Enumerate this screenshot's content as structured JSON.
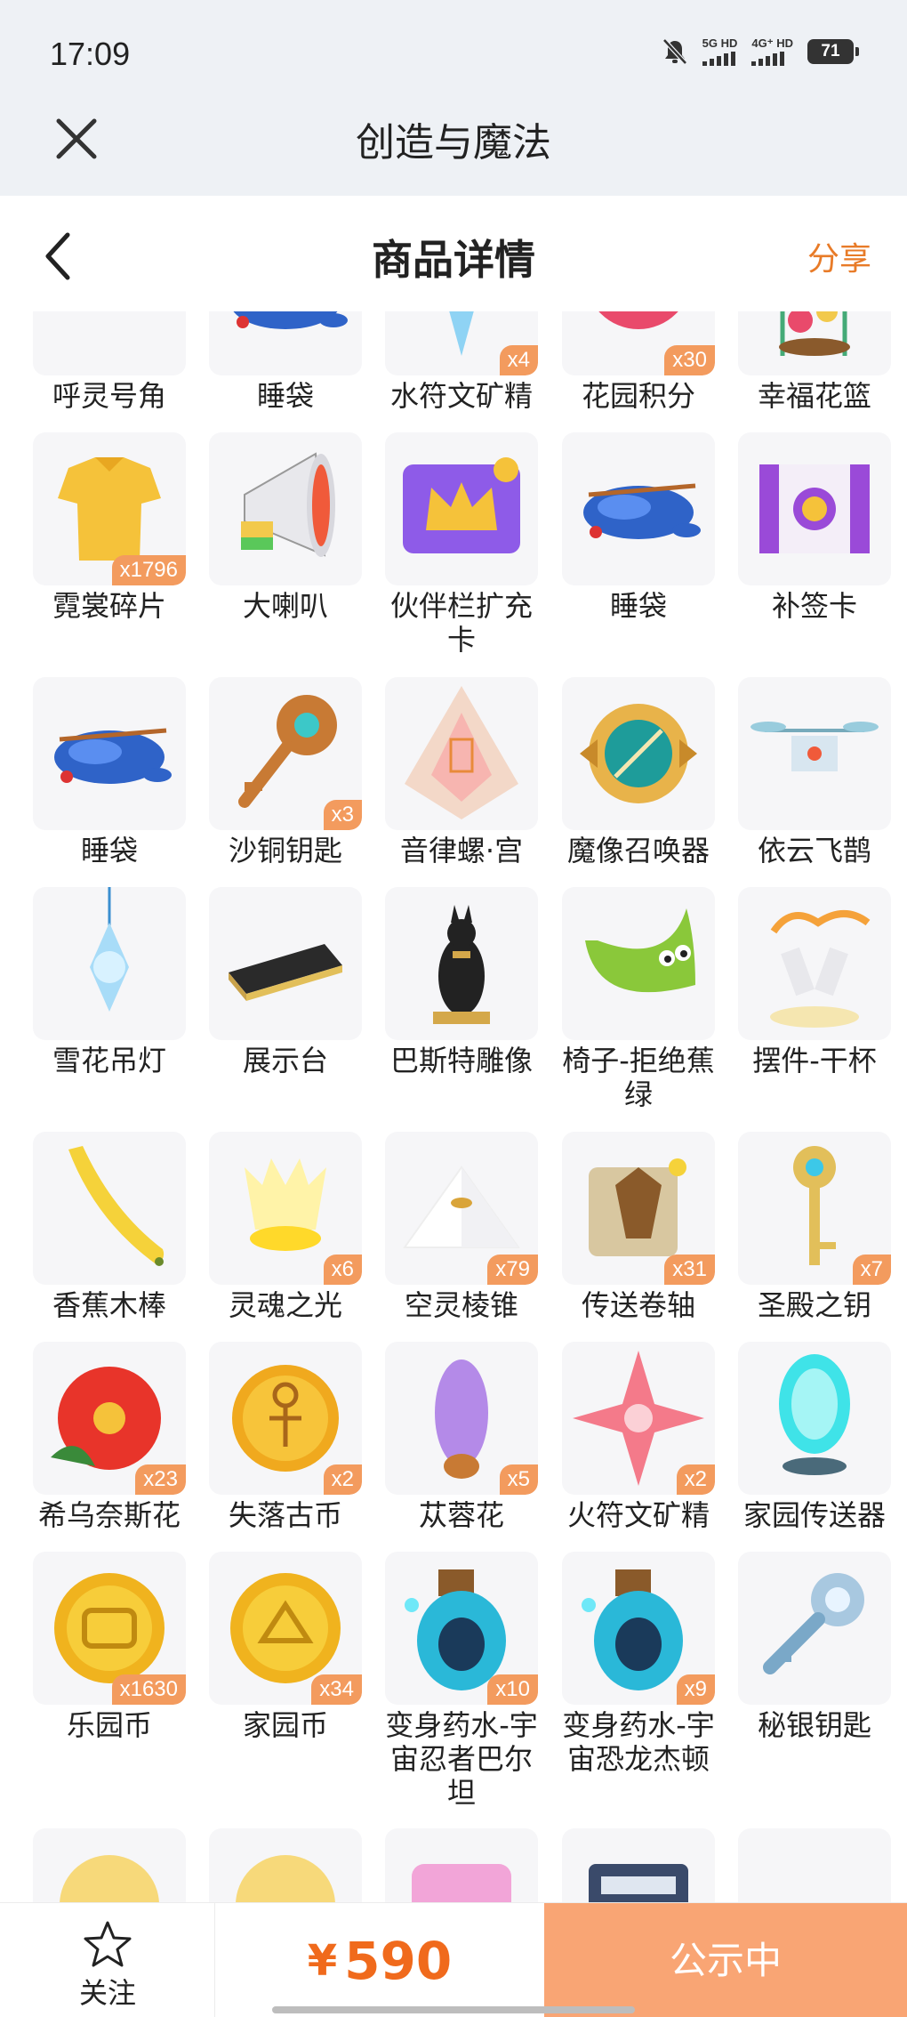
{
  "status_bar": {
    "time": "17:09",
    "net1": "5G HD",
    "net2": "4G⁺ HD",
    "battery": "71"
  },
  "app_bar": {
    "title": "创造与魔法"
  },
  "header": {
    "title": "商品详情",
    "share_label": "分享"
  },
  "colors": {
    "accent": "#e87b28",
    "price": "#f06a1c",
    "badge": "#f39b5e",
    "cta": "#f9a574"
  },
  "items": [
    {
      "name": "呼灵号角",
      "qty": "",
      "icon": "horn-icon"
    },
    {
      "name": "睡袋",
      "qty": "",
      "icon": "sleeping-bag-icon"
    },
    {
      "name": "水符文矿精",
      "qty": "x4",
      "icon": "ice-crystal-icon"
    },
    {
      "name": "花园积分",
      "qty": "x30",
      "icon": "flower-badge-icon"
    },
    {
      "name": "幸福花篮",
      "qty": "",
      "icon": "flower-basket-icon"
    },
    {
      "name": "霓裳碎片",
      "qty": "x1796",
      "icon": "shirt-icon"
    },
    {
      "name": "大喇叭",
      "qty": "",
      "icon": "megaphone-icon"
    },
    {
      "name": "伙伴栏扩充卡",
      "qty": "",
      "icon": "crown-card-icon"
    },
    {
      "name": "睡袋",
      "qty": "",
      "icon": "sleeping-bag-icon"
    },
    {
      "name": "补签卡",
      "qty": "",
      "icon": "ticket-icon"
    },
    {
      "name": "睡袋",
      "qty": "",
      "icon": "sleeping-bag-icon"
    },
    {
      "name": "沙铜钥匙",
      "qty": "x3",
      "icon": "bronze-key-icon"
    },
    {
      "name": "音律螺·宫",
      "qty": "",
      "icon": "conch-icon"
    },
    {
      "name": "魔像召唤器",
      "qty": "",
      "icon": "summoner-icon"
    },
    {
      "name": "依云飞鹊",
      "qty": "",
      "icon": "drone-icon"
    },
    {
      "name": "雪花吊灯",
      "qty": "",
      "icon": "snow-lamp-icon"
    },
    {
      "name": "展示台",
      "qty": "",
      "icon": "display-stand-icon"
    },
    {
      "name": "巴斯特雕像",
      "qty": "",
      "icon": "cat-statue-icon"
    },
    {
      "name": "椅子-拒绝蕉绿",
      "qty": "",
      "icon": "banana-chair-icon"
    },
    {
      "name": "摆件-干杯",
      "qty": "",
      "icon": "cheers-ornament-icon"
    },
    {
      "name": "香蕉木棒",
      "qty": "",
      "icon": "banana-club-icon"
    },
    {
      "name": "灵魂之光",
      "qty": "x6",
      "icon": "soul-light-icon"
    },
    {
      "name": "空灵棱锥",
      "qty": "x79",
      "icon": "pyramid-icon"
    },
    {
      "name": "传送卷轴",
      "qty": "x31",
      "icon": "scroll-icon"
    },
    {
      "name": "圣殿之钥",
      "qty": "x7",
      "icon": "temple-key-icon"
    },
    {
      "name": "希乌奈斯花",
      "qty": "x23",
      "icon": "red-flower-icon"
    },
    {
      "name": "失落古币",
      "qty": "x2",
      "icon": "ancient-coin-icon"
    },
    {
      "name": "苁蓉花",
      "qty": "x5",
      "icon": "purple-flower-icon"
    },
    {
      "name": "火符文矿精",
      "qty": "x2",
      "icon": "fire-crystal-icon"
    },
    {
      "name": "家园传送器",
      "qty": "",
      "icon": "teleporter-icon"
    },
    {
      "name": "乐园币",
      "qty": "x1630",
      "icon": "park-coin-icon"
    },
    {
      "name": "家园币",
      "qty": "x34",
      "icon": "home-coin-icon"
    },
    {
      "name": "变身药水-宇宙忍者巴尔坦",
      "qty": "x10",
      "icon": "potion-icon"
    },
    {
      "name": "变身药水-宇宙恐龙杰顿",
      "qty": "x9",
      "icon": "potion-icon"
    },
    {
      "name": "秘银钥匙",
      "qty": "",
      "icon": "mithril-key-icon"
    },
    {
      "name": "",
      "qty": "",
      "icon": "coin-partial-icon"
    },
    {
      "name": "",
      "qty": "",
      "icon": "coin-partial-icon"
    },
    {
      "name": "",
      "qty": "",
      "icon": "pink-partial-icon"
    },
    {
      "name": "",
      "qty": "",
      "icon": "box-partial-icon"
    },
    {
      "name": "",
      "qty": "",
      "icon": "blank-partial-icon"
    }
  ],
  "bottom": {
    "follow_label": "关注",
    "currency": "¥",
    "price": "590",
    "status_label": "公示中"
  }
}
